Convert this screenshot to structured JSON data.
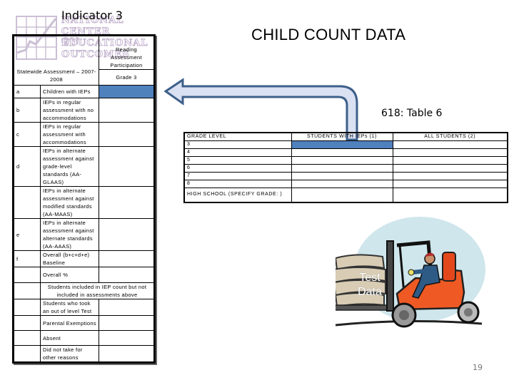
{
  "header": {
    "indicator_title": "Indicator 3",
    "main_title": "CHILD COUNT DATA",
    "table6_label": "618: Table 6",
    "logo": {
      "lines": [
        "NATIONAL",
        "CENTER ON",
        "EDUCATIONAL",
        "OUTCOMES"
      ]
    }
  },
  "left_table": {
    "header_right_top": "Reading Assessment Participation",
    "header_left": "Statewide Assessment – 2007-2008",
    "header_right_bottom": "Grade 3",
    "rows": [
      {
        "letter": "a",
        "label": "Children with IEPs",
        "value": "",
        "highlight": true
      },
      {
        "letter": "b",
        "label": "IEPs in regular assessment with no accommodations",
        "value": ""
      },
      {
        "letter": "c",
        "label": "IEPs in regular assessment with accommodations",
        "value": ""
      },
      {
        "letter": "d",
        "label": "IEPs in alternate assessment against grade-level standards (AA-GLAAS)",
        "value": ""
      },
      {
        "letter": "",
        "label": "IEPs in alternate assessment against modified standards (AA-MAAS)",
        "value": ""
      },
      {
        "letter": "e",
        "label": "IEPs in alternate assessment against alternate standards (AA-AAAS)",
        "value": ""
      },
      {
        "letter": "f",
        "label": "Overall (b+c+d+e) Baseline",
        "value": ""
      },
      {
        "letter": "",
        "label": "Overall %",
        "value": ""
      }
    ],
    "span_row": "Students included in IEP count but not included in assessments above",
    "bottom_rows": [
      {
        "letter": "",
        "label": "Students who took an out of level Test",
        "value": ""
      },
      {
        "letter": "",
        "label": "Parental Exemptions",
        "value": ""
      },
      {
        "letter": "",
        "label": "Absent",
        "value": ""
      },
      {
        "letter": "",
        "label": "Did not take for other reasons",
        "value": ""
      }
    ]
  },
  "right_table": {
    "headers": [
      "GRADE LEVEL",
      "STUDENTS WITH IEPs (1)",
      "ALL STUDENTS (2)"
    ],
    "rows": [
      {
        "grade": "3",
        "iep": "",
        "all": "",
        "highlight": true
      },
      {
        "grade": "4",
        "iep": "",
        "all": ""
      },
      {
        "grade": "5",
        "iep": "",
        "all": ""
      },
      {
        "grade": "6",
        "iep": "",
        "all": ""
      },
      {
        "grade": "7",
        "iep": "",
        "all": ""
      },
      {
        "grade": "8",
        "iep": "",
        "all": ""
      },
      {
        "grade": "HIGH SCHOOL (SPECIFY GRADE: )",
        "iep": "",
        "all": ""
      }
    ]
  },
  "clipart": {
    "label_line1": "Test",
    "label_line2": "Data"
  },
  "colors": {
    "highlight_fill": "#4f81bd",
    "arrow_fill": "#d9e1f2",
    "arrow_stroke": "#3e5f8a"
  },
  "footer": {
    "page_number": "19"
  }
}
